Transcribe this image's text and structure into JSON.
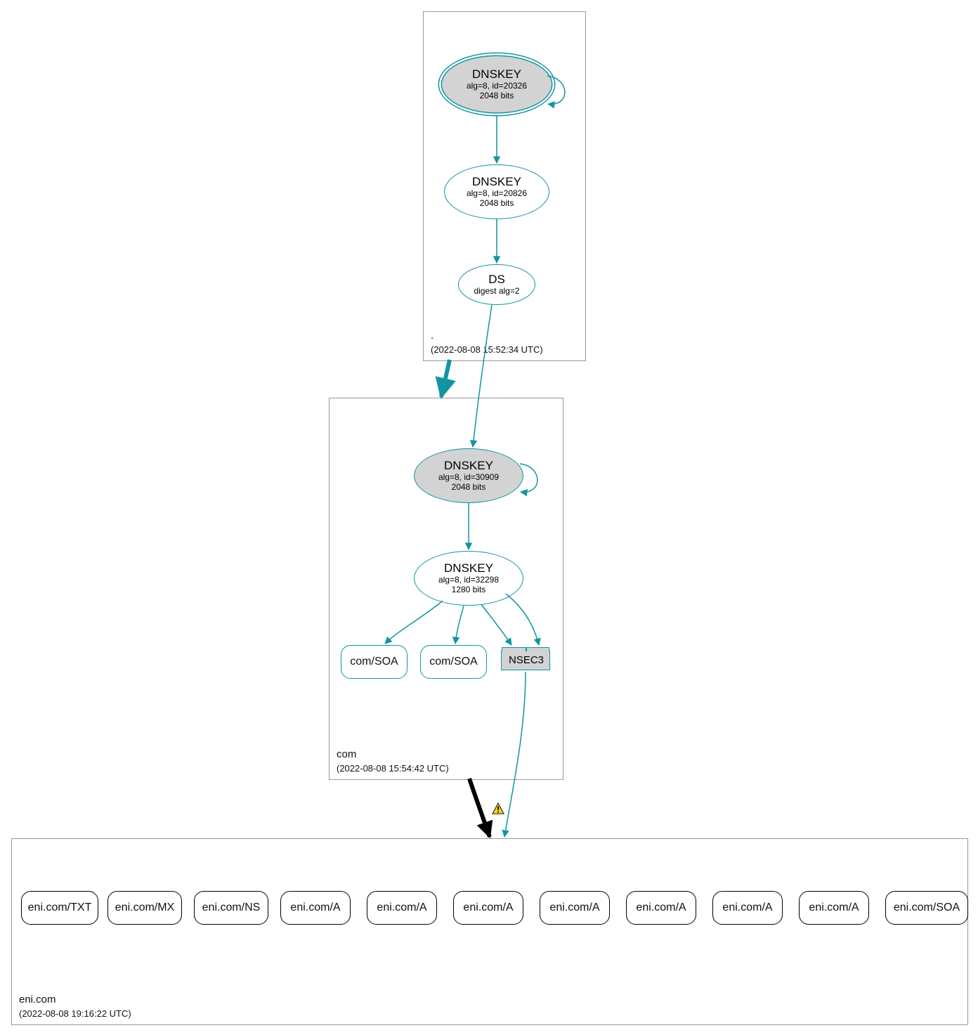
{
  "colors": {
    "teal": "#1195a0",
    "grey": "#d3d3d3",
    "black": "#000000",
    "warn_fill": "#f5d016",
    "warn_stroke": "#000000"
  },
  "zones": {
    "root": {
      "name": ".",
      "timestamp": "(2022-08-08 15:52:34 UTC)",
      "nodes": {
        "ksk": {
          "title": "DNSKEY",
          "meta1": "alg=8, id=20326",
          "meta2": "2048 bits"
        },
        "zsk": {
          "title": "DNSKEY",
          "meta1": "alg=8, id=20826",
          "meta2": "2048 bits"
        },
        "ds": {
          "title": "DS",
          "meta1": "digest alg=2",
          "meta2": ""
        }
      }
    },
    "com": {
      "name": "com",
      "timestamp": "(2022-08-08 15:54:42 UTC)",
      "nodes": {
        "ksk": {
          "title": "DNSKEY",
          "meta1": "alg=8, id=30909",
          "meta2": "2048 bits"
        },
        "zsk": {
          "title": "DNSKEY",
          "meta1": "alg=8, id=32298",
          "meta2": "1280 bits"
        },
        "soa1": {
          "title": "com/SOA"
        },
        "soa2": {
          "title": "com/SOA"
        },
        "nsec3": {
          "title": "NSEC3"
        }
      }
    },
    "eni": {
      "name": "eni.com",
      "timestamp": "(2022-08-08 19:16:22 UTC)",
      "records": [
        "eni.com/TXT",
        "eni.com/MX",
        "eni.com/NS",
        "eni.com/A",
        "eni.com/A",
        "eni.com/A",
        "eni.com/A",
        "eni.com/A",
        "eni.com/A",
        "eni.com/A",
        "eni.com/SOA"
      ]
    }
  }
}
